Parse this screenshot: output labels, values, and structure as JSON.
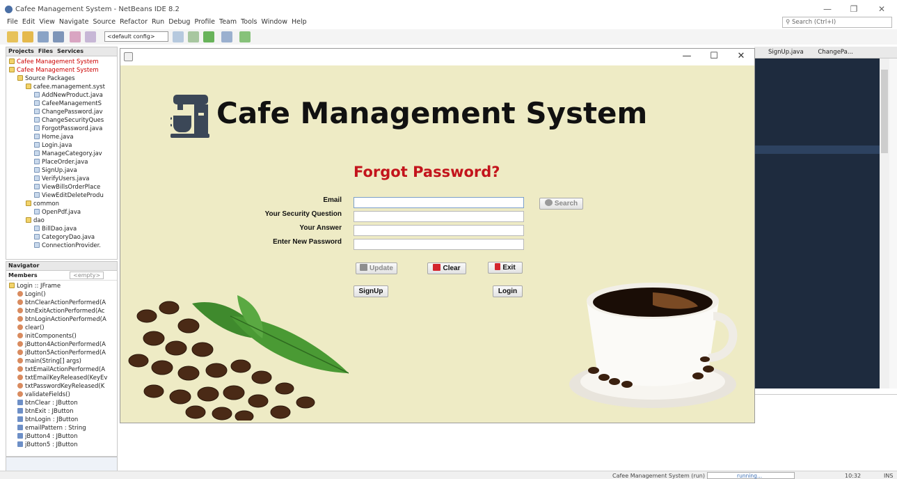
{
  "ide": {
    "title": "Cafee Management System - NetBeans IDE 8.2",
    "menu": [
      "File",
      "Edit",
      "View",
      "Navigate",
      "Source",
      "Refactor",
      "Run",
      "Debug",
      "Profile",
      "Team",
      "Tools",
      "Window",
      "Help"
    ],
    "search_placeholder": "Search (Ctrl+I)",
    "config": "<default config>",
    "projects_tabs": [
      "Projects",
      "Files",
      "Services"
    ],
    "tree": [
      {
        "label": "Cafee Management System",
        "indent": 0,
        "red": true,
        "icon": "project"
      },
      {
        "label": "Cafee Management System",
        "indent": 0,
        "red": true,
        "icon": "project"
      },
      {
        "label": "Source Packages",
        "indent": 1,
        "icon": "package"
      },
      {
        "label": "cafee.management.syst",
        "indent": 2,
        "icon": "package"
      },
      {
        "label": "AddNewProduct.java",
        "indent": 3,
        "icon": "file"
      },
      {
        "label": "CafeeManagementS",
        "indent": 3,
        "icon": "file"
      },
      {
        "label": "ChangePassword.jav",
        "indent": 3,
        "icon": "file"
      },
      {
        "label": "ChangeSecurityQues",
        "indent": 3,
        "icon": "file"
      },
      {
        "label": "ForgotPassword.java",
        "indent": 3,
        "icon": "file"
      },
      {
        "label": "Home.java",
        "indent": 3,
        "icon": "file"
      },
      {
        "label": "Login.java",
        "indent": 3,
        "icon": "file"
      },
      {
        "label": "ManageCategory.jav",
        "indent": 3,
        "icon": "file"
      },
      {
        "label": "PlaceOrder.java",
        "indent": 3,
        "icon": "file"
      },
      {
        "label": "SignUp.java",
        "indent": 3,
        "icon": "file"
      },
      {
        "label": "VerifyUsers.java",
        "indent": 3,
        "icon": "file"
      },
      {
        "label": "ViewBillsOrderPlace",
        "indent": 3,
        "icon": "file"
      },
      {
        "label": "ViewEditDeleteProdu",
        "indent": 3,
        "icon": "file"
      },
      {
        "label": "common",
        "indent": 2,
        "icon": "package"
      },
      {
        "label": "OpenPdf.java",
        "indent": 3,
        "icon": "file"
      },
      {
        "label": "dao",
        "indent": 2,
        "icon": "package"
      },
      {
        "label": "BillDao.java",
        "indent": 3,
        "icon": "file"
      },
      {
        "label": "CategoryDao.java",
        "indent": 3,
        "icon": "file"
      },
      {
        "label": "ConnectionProvider.",
        "indent": 3,
        "icon": "file"
      }
    ],
    "navigator_tab": "Navigator",
    "members_label": "Members",
    "members_filter": "<empty>",
    "nav_tree": [
      {
        "label": "Login :: JFrame",
        "indent": 0,
        "icon": "class"
      },
      {
        "label": "Login()",
        "indent": 1,
        "icon": "method"
      },
      {
        "label": "btnClearActionPerformed(A",
        "indent": 1,
        "icon": "method"
      },
      {
        "label": "btnExitActionPerformed(Ac",
        "indent": 1,
        "icon": "method"
      },
      {
        "label": "btnLoginActionPerformed(A",
        "indent": 1,
        "icon": "method"
      },
      {
        "label": "clear()",
        "indent": 1,
        "icon": "method"
      },
      {
        "label": "initComponents()",
        "indent": 1,
        "icon": "method"
      },
      {
        "label": "jButton4ActionPerformed(A",
        "indent": 1,
        "icon": "method"
      },
      {
        "label": "jButton5ActionPerformed(A",
        "indent": 1,
        "icon": "method"
      },
      {
        "label": "main(String[] args)",
        "indent": 1,
        "icon": "method"
      },
      {
        "label": "txtEmailActionPerformed(A",
        "indent": 1,
        "icon": "method"
      },
      {
        "label": "txtEmailKeyReleased(KeyEv",
        "indent": 1,
        "icon": "method"
      },
      {
        "label": "txtPasswordKeyReleased(K",
        "indent": 1,
        "icon": "method"
      },
      {
        "label": "validateFields()",
        "indent": 1,
        "icon": "method"
      },
      {
        "label": "btnClear : JButton",
        "indent": 1,
        "icon": "field"
      },
      {
        "label": "btnExit : JButton",
        "indent": 1,
        "icon": "field"
      },
      {
        "label": "btnLogin : JButton",
        "indent": 1,
        "icon": "field"
      },
      {
        "label": "emailPattern : String",
        "indent": 1,
        "icon": "field"
      },
      {
        "label": "jButton4 : JButton",
        "indent": 1,
        "icon": "field"
      },
      {
        "label": "jButton5 : JButton",
        "indent": 1,
        "icon": "field"
      }
    ],
    "editor_tabs": [
      "SignUp.java",
      "ChangePa..."
    ],
    "status": {
      "project": "Cafee Management System (run)",
      "state": "running...",
      "time": "10:32",
      "mode": "INS"
    }
  },
  "app": {
    "heading": "Cafe Management System",
    "subheading": "Forgot Password?",
    "fields": [
      {
        "label": "Email",
        "value": ""
      },
      {
        "label": "Your Security Question",
        "value": ""
      },
      {
        "label": "Your Answer",
        "value": ""
      },
      {
        "label": "Enter New Password",
        "value": ""
      }
    ],
    "buttons": {
      "search": "Search",
      "update": "Update",
      "clear": "Clear",
      "exit": "Exit",
      "signup": "SignUp",
      "login": "Login"
    }
  },
  "colors": {
    "app_bg": "#eeebc5",
    "heading": "#111111",
    "subheading": "#c3141c",
    "editor_bg": "#1e2b3e"
  }
}
